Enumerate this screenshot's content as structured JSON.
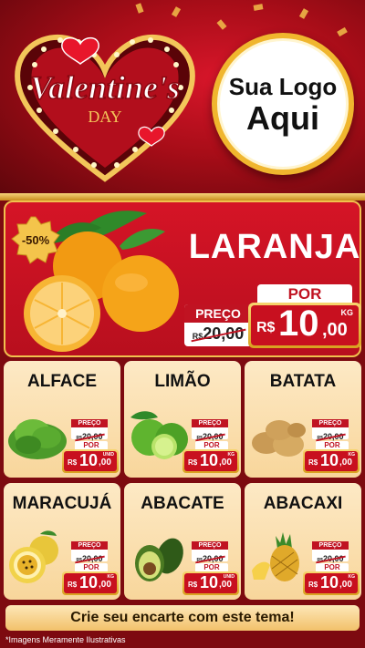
{
  "header": {
    "brand_title": "Valentine's",
    "brand_subtitle": "DAY",
    "logo_line1": "Sua Logo",
    "logo_line2": "Aqui"
  },
  "featured": {
    "discount": "-50%",
    "name": "LARANJA",
    "preco_label": "PREÇO",
    "old_currency": "R$",
    "old_price": "20,00",
    "por_label": "POR",
    "currency": "R$",
    "price_int": "10",
    "price_dec": ",00",
    "unit": "KG"
  },
  "products": [
    {
      "name": "ALFACE",
      "preco_label": "PREÇO",
      "old_currency": "R$",
      "old_price": "20,00",
      "por_label": "POR",
      "currency": "R$",
      "price_int": "10",
      "price_dec": ",00",
      "unit": "UNID"
    },
    {
      "name": "LIMÃO",
      "preco_label": "PREÇO",
      "old_currency": "R$",
      "old_price": "20,00",
      "por_label": "POR",
      "currency": "R$",
      "price_int": "10",
      "price_dec": ",00",
      "unit": "KG"
    },
    {
      "name": "BATATA",
      "preco_label": "PREÇO",
      "old_currency": "R$",
      "old_price": "20,00",
      "por_label": "POR",
      "currency": "R$",
      "price_int": "10",
      "price_dec": ",00",
      "unit": "KG"
    },
    {
      "name": "MARACUJÁ",
      "preco_label": "PREÇO",
      "old_currency": "R$",
      "old_price": "20,00",
      "por_label": "POR",
      "currency": "R$",
      "price_int": "10",
      "price_dec": ",00",
      "unit": "KG"
    },
    {
      "name": "ABACATE",
      "preco_label": "PREÇO",
      "old_currency": "R$",
      "old_price": "20,00",
      "por_label": "POR",
      "currency": "R$",
      "price_int": "10",
      "price_dec": ",00",
      "unit": "UNID"
    },
    {
      "name": "ABACAXI",
      "preco_label": "PREÇO",
      "old_currency": "R$",
      "old_price": "20,00",
      "por_label": "POR",
      "currency": "R$",
      "price_int": "10",
      "price_dec": ",00",
      "unit": "KG"
    }
  ],
  "cta": "Crie seu encarte com este tema!",
  "disclaimer": "*Imagens Meramente Ilustrativas",
  "colors": {
    "accent_red": "#c8101f",
    "gold": "#f1c14e",
    "card_bg": "#fde9c5"
  }
}
